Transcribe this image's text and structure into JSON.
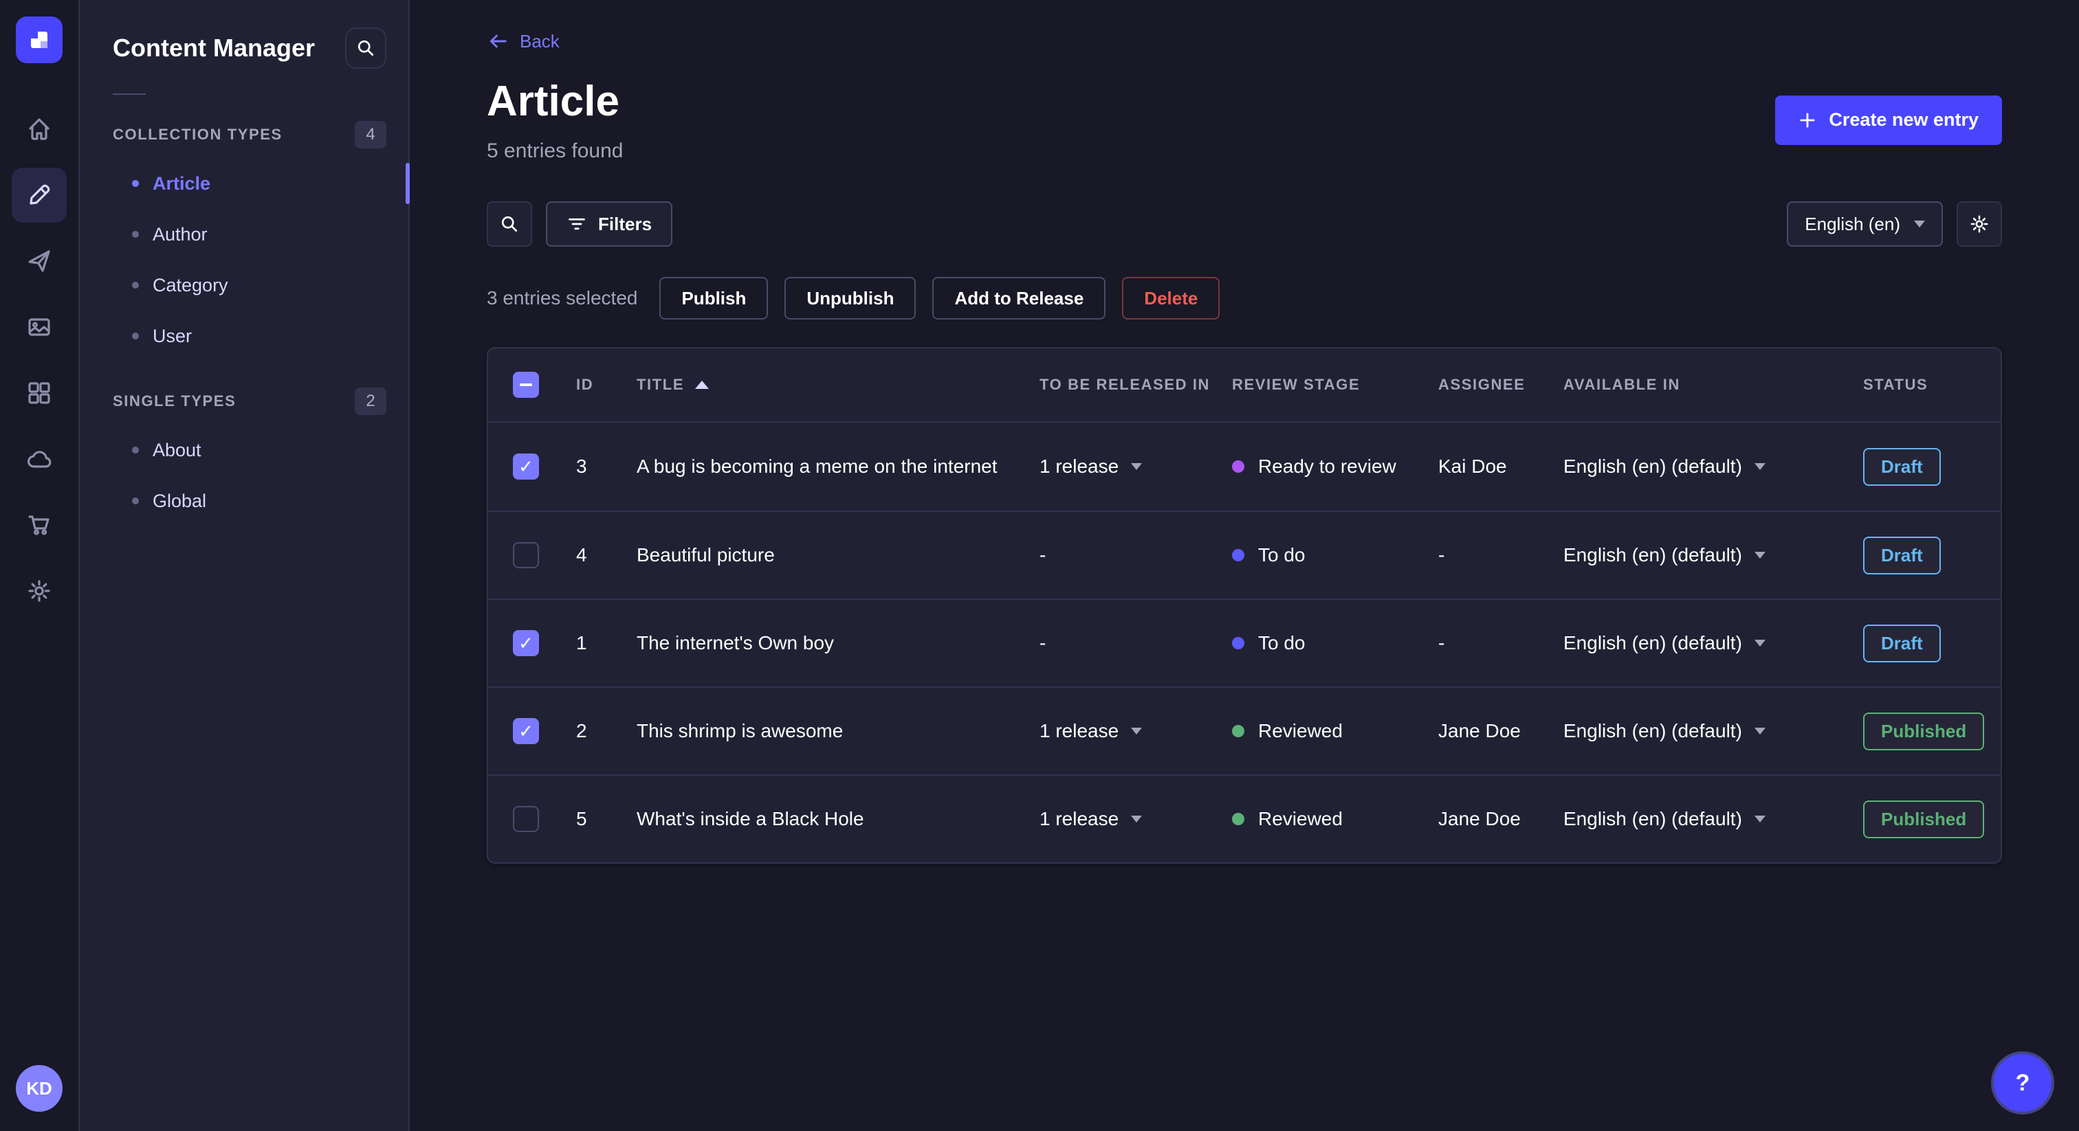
{
  "nav_rail": {
    "logo": "strapi-logo",
    "icons": [
      {
        "name": "home",
        "active": false
      },
      {
        "name": "content-manager",
        "active": true
      },
      {
        "name": "releases",
        "active": false
      },
      {
        "name": "media-library",
        "active": false
      },
      {
        "name": "content-type-builder",
        "active": false
      },
      {
        "name": "deploy",
        "active": false
      },
      {
        "name": "marketplace",
        "active": false
      },
      {
        "name": "settings",
        "active": false
      }
    ],
    "avatar_initials": "KD"
  },
  "sidebar": {
    "title": "Content Manager",
    "sections": [
      {
        "label": "COLLECTION TYPES",
        "badge": "4",
        "items": [
          {
            "label": "Article",
            "active": true
          },
          {
            "label": "Author",
            "active": false
          },
          {
            "label": "Category",
            "active": false
          },
          {
            "label": "User",
            "active": false
          }
        ]
      },
      {
        "label": "SINGLE TYPES",
        "badge": "2",
        "items": [
          {
            "label": "About",
            "active": false
          },
          {
            "label": "Global",
            "active": false
          }
        ]
      }
    ]
  },
  "header": {
    "back_label": "Back",
    "title": "Article",
    "subtitle": "5 entries found",
    "create_button_label": "Create new entry"
  },
  "toolbar": {
    "filters_label": "Filters",
    "locale_selected": "English (en)"
  },
  "selection": {
    "label": "3 entries selected",
    "publish_label": "Publish",
    "unpublish_label": "Unpublish",
    "add_to_release_label": "Add to Release",
    "delete_label": "Delete"
  },
  "table": {
    "headers": {
      "id": "ID",
      "title": "TITLE",
      "release": "TO BE RELEASED IN",
      "stage": "REVIEW STAGE",
      "assignee": "ASSIGNEE",
      "available": "AVAILABLE IN",
      "status": "STATUS"
    },
    "rows": [
      {
        "checked": true,
        "id": "3",
        "title": "A bug is becoming a meme on the internet",
        "release": "1 release",
        "release_caret": true,
        "stage": "Ready to review",
        "stage_key": "ready",
        "assignee": "Kai Doe",
        "locale": "English (en) (default)",
        "status": "Draft",
        "status_key": "draft"
      },
      {
        "checked": false,
        "id": "4",
        "title": "Beautiful picture",
        "release": "-",
        "release_caret": false,
        "stage": "To do",
        "stage_key": "todo",
        "assignee": "-",
        "locale": "English (en) (default)",
        "status": "Draft",
        "status_key": "draft"
      },
      {
        "checked": true,
        "id": "1",
        "title": "The internet's Own boy",
        "release": "-",
        "release_caret": false,
        "stage": "To do",
        "stage_key": "todo",
        "assignee": "-",
        "locale": "English (en) (default)",
        "status": "Draft",
        "status_key": "draft"
      },
      {
        "checked": true,
        "id": "2",
        "title": "This shrimp is awesome",
        "release": "1 release",
        "release_caret": true,
        "stage": "Reviewed",
        "stage_key": "reviewed",
        "assignee": "Jane Doe",
        "locale": "English (en) (default)",
        "status": "Published",
        "status_key": "published"
      },
      {
        "checked": false,
        "id": "5",
        "title": "What's inside a Black Hole",
        "release": "1 release",
        "release_caret": true,
        "stage": "Reviewed",
        "stage_key": "reviewed",
        "assignee": "Jane Doe",
        "locale": "English (en) (default)",
        "status": "Published",
        "status_key": "published"
      }
    ]
  },
  "colors": {
    "primary": "#4945ff",
    "primary_light": "#7b79ff",
    "stage_dots": {
      "ready": "#ac56f5",
      "todo": "#5b5bff",
      "reviewed": "#5cb176"
    },
    "status_badges": {
      "draft": "#66b7f1",
      "published": "#5cb176"
    },
    "danger": "#ee5e52"
  },
  "help": {
    "label": "?"
  }
}
